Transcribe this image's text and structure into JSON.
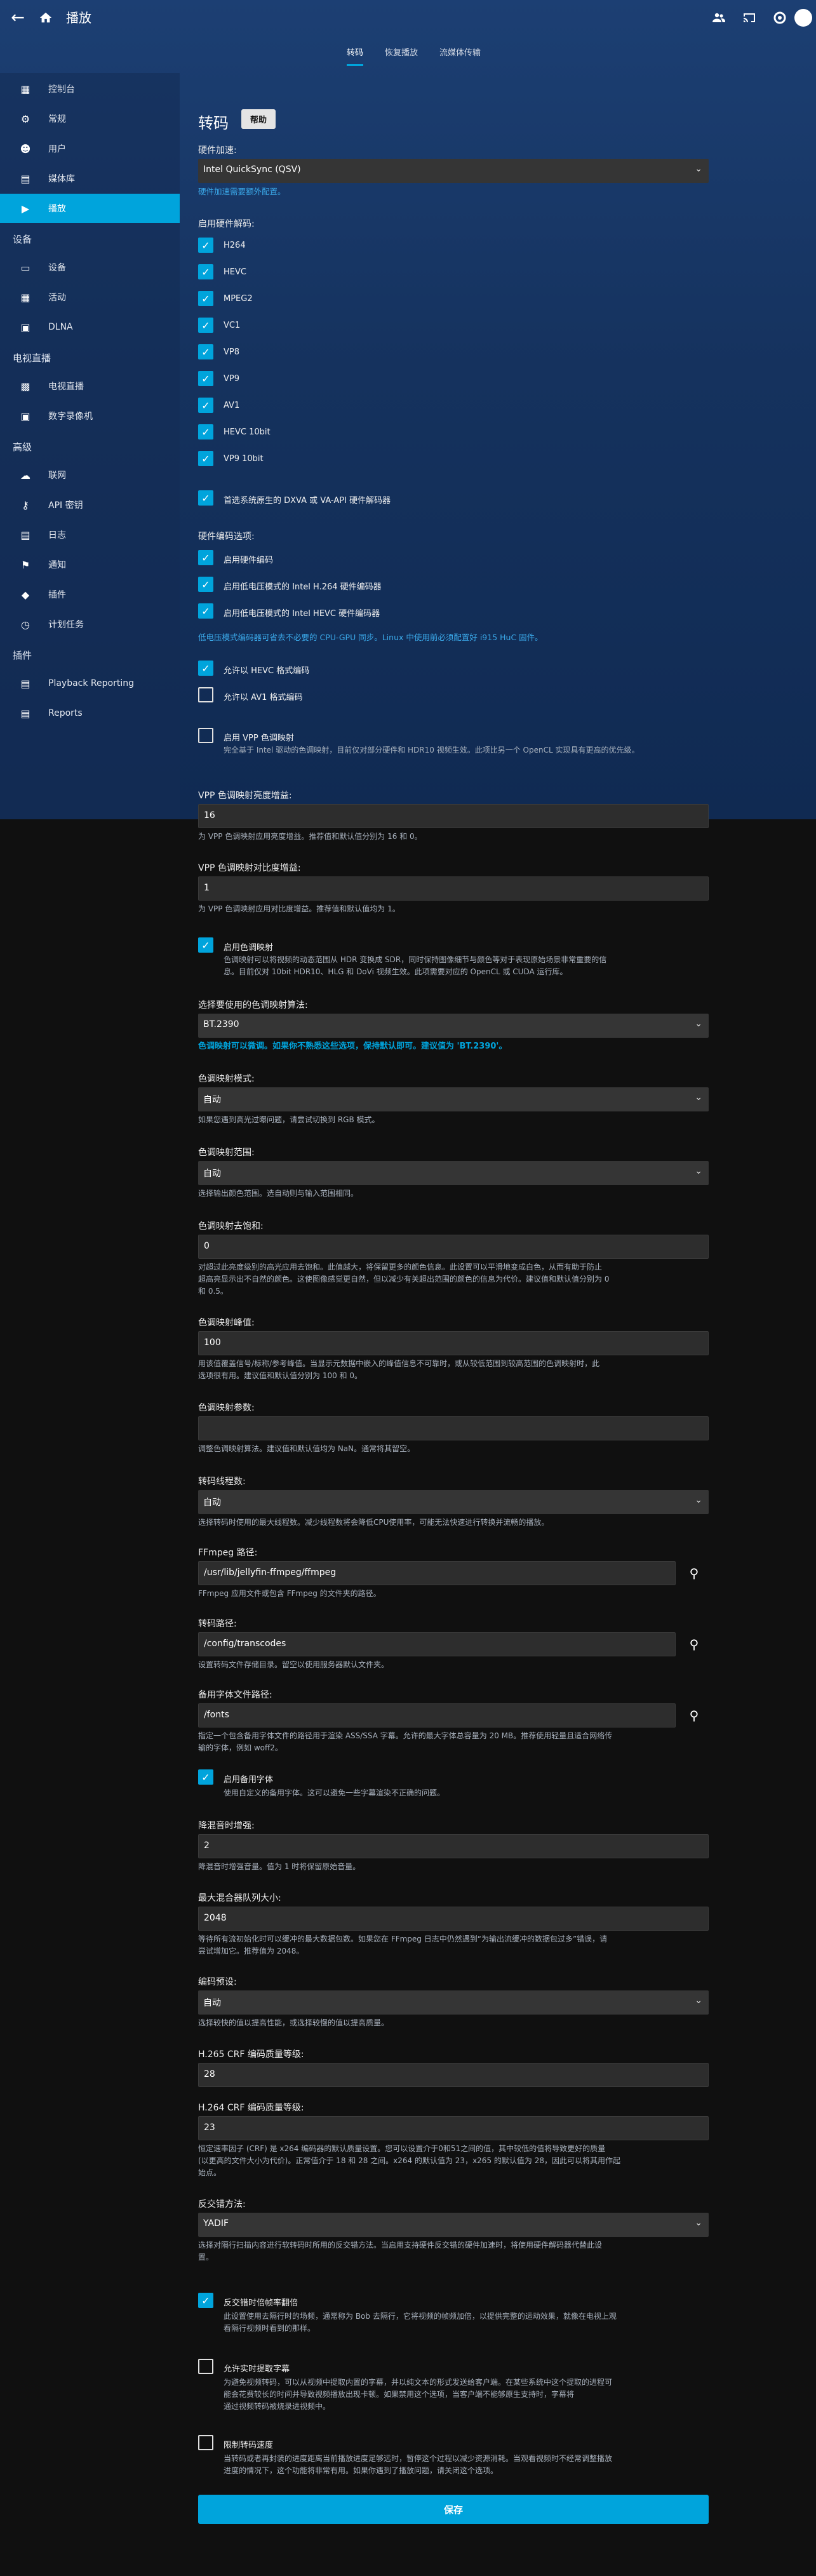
{
  "header": {
    "title": "播放",
    "tabs": [
      "转码",
      "恢复播放",
      "流媒体传输"
    ]
  },
  "sidebar": {
    "items_top": [
      {
        "icon": "dashboard-icon",
        "label": "控制台"
      },
      {
        "icon": "gear-icon",
        "label": "常规"
      },
      {
        "icon": "users-icon",
        "label": "用户"
      },
      {
        "icon": "folder-icon",
        "label": "媒体库"
      },
      {
        "icon": "play-icon",
        "label": "播放"
      }
    ],
    "section_devices": "设备",
    "items_devices": [
      {
        "icon": "devices-icon",
        "label": "设备"
      },
      {
        "icon": "activity-icon",
        "label": "活动"
      },
      {
        "icon": "dlna-icon",
        "label": "DLNA"
      }
    ],
    "section_livetv": "电视直播",
    "items_livetv": [
      {
        "icon": "tv-icon",
        "label": "电视直播"
      },
      {
        "icon": "dvr-icon",
        "label": "数字录像机"
      }
    ],
    "section_advanced": "高级",
    "items_advanced": [
      {
        "icon": "cloud-icon",
        "label": "联网"
      },
      {
        "icon": "key-icon",
        "label": "API 密钥"
      },
      {
        "icon": "log-icon",
        "label": "日志"
      },
      {
        "icon": "bell-icon",
        "label": "通知"
      },
      {
        "icon": "plugin-icon",
        "label": "插件"
      },
      {
        "icon": "schedule-icon",
        "label": "计划任务"
      }
    ],
    "section_plugins": "插件",
    "items_plugins": [
      {
        "icon": "folder-icon",
        "label": "Playback Reporting"
      },
      {
        "icon": "folder-icon",
        "label": "Reports"
      }
    ]
  },
  "content": {
    "title": "转码",
    "help": "帮助",
    "hw_accel_label": "硬件加速:",
    "hw_accel_value": "Intel QuickSync (QSV)",
    "hw_accel_link": "硬件加速需要额外配置。",
    "decode_label": "启用硬件解码:",
    "decoders": [
      "H264",
      "HEVC",
      "MPEG2",
      "VC1",
      "VP8",
      "VP9",
      "AV1",
      "HEVC 10bit",
      "VP9 10bit"
    ],
    "dxva_label": "首选系统原生的 DXVA 或 VA-API 硬件解码器",
    "encode_label": "硬件编码选项:",
    "encode_options": [
      "启用硬件编码",
      "启用低电压模式的 Intel H.264 硬件编码器",
      "启用低电压模式的 Intel HEVC 硬件编码器"
    ],
    "lowpower_note": "低电压模式编码器可省去不必要的 CPU-GPU 同步。Linux 中使用前必须配置好 i915 HuC 固件。",
    "allow_hevc": "允许以 HEVC 格式编码",
    "allow_av1": "允许以 AV1 格式编码",
    "vpp_label": "启用 VPP 色调映射",
    "vpp_desc": "完全基于 Intel 驱动的色调映射，目前仅对部分硬件和 HDR10 视频生效。此项比另一个 OpenCL 实现具有更高的优先级。",
    "vpp_brightness_label": "VPP 色调映射亮度增益:",
    "vpp_brightness_value": "16",
    "vpp_brightness_desc": "为 VPP 色调映射应用亮度增益。推荐值和默认值分别为 16 和 0。",
    "vpp_contrast_label": "VPP 色调映射对比度增益:",
    "vpp_contrast_value": "1",
    "vpp_contrast_desc": "为 VPP 色调映射应用对比度增益。推荐值和默认值均为 1。",
    "tonemap_label": "启用色调映射",
    "tonemap_desc_1": "色调映射可以将视频的动态范围从 HDR 变换成 SDR，同时保持图像细节与颜色等对于表现原始场景非常重要的信",
    "tonemap_desc_2": "息。目前仅对 10bit HDR10、HLG 和 DoVi 视频生效。此项需要对应的 OpenCL 或 CUDA 运行库。",
    "algo_label": "选择要使用的色调映射算法:",
    "algo_value": "BT.2390",
    "algo_note": "色调映射可以微调。如果你不熟悉这些选项，保持默认即可。建议值为 'BT.2390'。",
    "tm_mode_label": "色调映射模式:",
    "tm_mode_value": "自动",
    "tm_mode_desc": "如果您遇到高光过曝问题，请尝试切换到 RGB 模式。",
    "tm_range_label": "色调映射范围:",
    "tm_range_value": "自动",
    "tm_range_desc": "选择输出颜色范围。选自动则与输入范围相同。",
    "desat_label": "色调映射去饱和:",
    "desat_value": "0",
    "desat_desc_1": "对超过此亮度级别的高光应用去饱和。此值越大，将保留更多的颜色信息。此设置可以平滑地变成白色，从而有助于防止",
    "desat_desc_2": "超高亮显示出不自然的颜色。这使图像感觉更自然，但以减少有关超出范围的颜色的信息为代价。建议值和默认值分别为 0",
    "desat_desc_3": "和 0.5。",
    "peak_label": "色调映射峰值:",
    "peak_value": "100",
    "peak_desc_1": "用该值覆盖信号/标称/参考峰值。当显示元数据中嵌入的峰值信息不可靠时，或从较低范围到较高范围的色调映射时，此",
    "peak_desc_2": "选项很有用。建议值和默认值分别为 100 和 0。",
    "param_label": "色调映射参数:",
    "param_value": "",
    "param_desc": "调整色调映射算法。建议值和默认值均为 NaN。通常将其留空。",
    "threads_label": "转码线程数:",
    "threads_value": "自动",
    "threads_desc": "选择转码时使用的最大线程数。减少线程数将会降低CPU使用率，可能无法快速进行转换并流畅的播放。",
    "ffmpeg_label": "FFmpeg 路径:",
    "ffmpeg_value": "/usr/lib/jellyfin-ffmpeg/ffmpeg",
    "ffmpeg_desc": "FFmpeg 应用文件或包含 FFmpeg 的文件夹的路径。",
    "transcode_path_label": "转码路径:",
    "transcode_path_value": "/config/transcodes",
    "transcode_path_desc": "设置转码文件存储目录。留空以使用服务器默认文件夹。",
    "fallback_label": "备用字体文件路径:",
    "fallback_value": "/fonts",
    "fallback_desc_1": "指定一个包含备用字体文件的路径用于渲染 ASS/SSA 字幕。允许的最大字体总容量为 20 MB。推荐使用轻量且适合网络传",
    "fallback_desc_2": "输的字体，例如 woff2。",
    "enable_fallback_label": "启用备用字体",
    "enable_fallback_desc": "使用自定义的备用字体。这可以避免一些字幕渲染不正确的问题。",
    "downmix_label": "降混音时增强:",
    "downmix_value": "2",
    "downmix_desc": "降混音时增强音量。值为 1 时将保留原始音量。",
    "mux_label": "最大混合器队列大小:",
    "mux_value": "2048",
    "mux_desc_1": "等待所有流初始化时可以缓冲的最大数据包数。如果您在 FFmpeg 日志中仍然遇到“为输出流缓冲的数据包过多”错误，请",
    "mux_desc_2": "尝试增加它。推荐值为 2048。",
    "preset_label": "编码预设:",
    "preset_value": "自动",
    "preset_desc": "选择较快的值以提高性能，或选择较慢的值以提高质量。",
    "h265_label": "H.265 CRF 编码质量等级:",
    "h265_value": "28",
    "h264_label": "H.264 CRF 编码质量等级:",
    "h264_value": "23",
    "crf_desc_1": "恒定速率因子 (CRF) 是 x264 编码器的默认质量设置。您可以设置介于0和51之间的值，其中较低的值将导致更好的质量",
    "crf_desc_2": "(以更高的文件大小为代价)。正常值介于 18 和 28 之间。x264 的默认值为 23，x265 的默认值为 28，因此可以将其用作起",
    "crf_desc_3": "始点。",
    "deint_label": "反交错方法:",
    "deint_value": "YADIF",
    "deint_desc_1": "选择对隔行扫描内容进行软转码时所用的反交错方法。当启用支持硬件反交错的硬件加速时，将使用硬件解码器代替此设",
    "deint_desc_2": "置。",
    "bob_label": "反交错时倍帧率翻倍",
    "bob_desc_1": "此设置使用去隔行时的场频，通常称为 Bob 去隔行，它将视频的帧频加倍，以提供完整的运动效果，就像在电视上观",
    "bob_desc_2": "看隔行视频时看到的那样。",
    "subtitle_label": "允许实时提取字幕",
    "subtitle_desc_1": "为避免视频转码，可以从视频中提取内置的字幕，并以纯文本的形式发送给客户端。在某些系统中这个提取的进程可",
    "subtitle_desc_2": "能会花费较长的时间并导致视频播放出现卡顿。如果禁用这个选项，当客户端不能够原生支持时，字幕将",
    "subtitle_desc_3": "通过视频转码被烧录进视频中。",
    "throttle_label": "限制转码速度",
    "throttle_desc_1": "当转码或者再封装的进度距离当前播放进度足够远时，暂停这个过程以减少资源消耗。当观看视频时不经常调整播放",
    "throttle_desc_2": "进度的情况下，这个功能将非常有用。如果你遇到了播放问题，请关闭这个选项。",
    "save": "保存"
  }
}
